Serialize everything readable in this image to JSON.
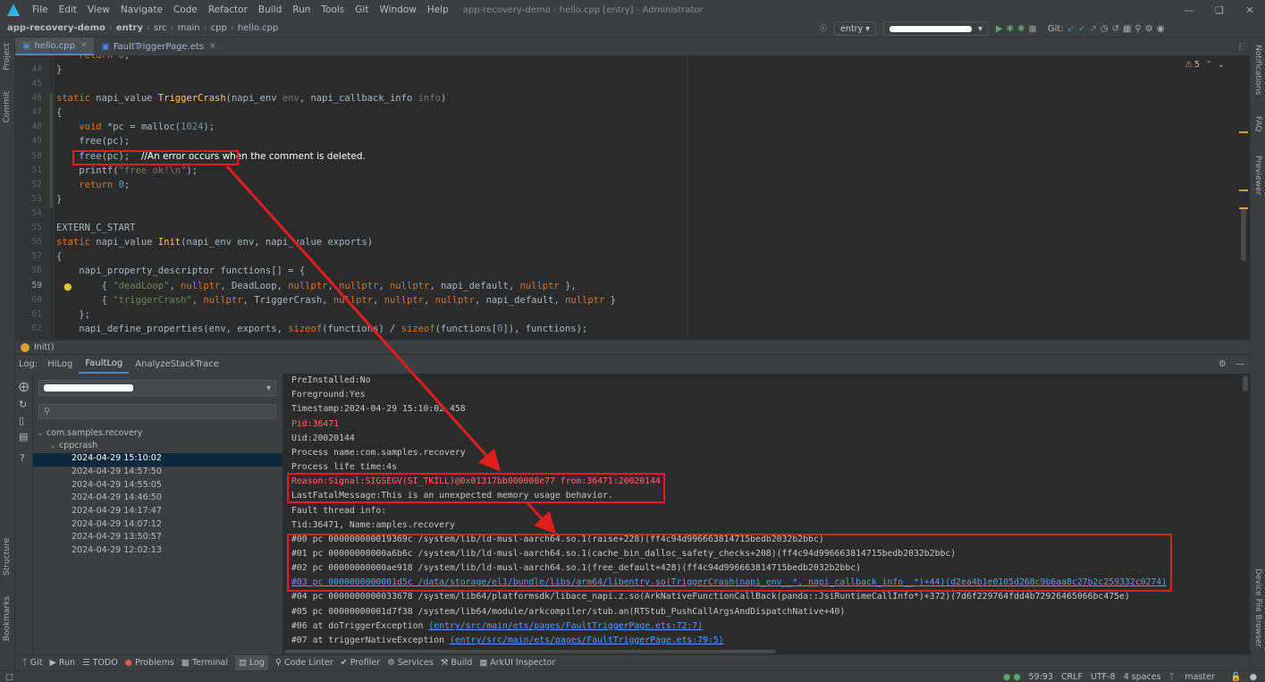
{
  "menu": {
    "items": [
      "File",
      "Edit",
      "View",
      "Navigate",
      "Code",
      "Refactor",
      "Build",
      "Run",
      "Tools",
      "Git",
      "Window",
      "Help"
    ],
    "window_title": "app-recovery-demo - hello.cpp [entry] - Administrator"
  },
  "navbar": {
    "breadcrumbs": [
      "app-recovery-demo",
      "entry",
      "src",
      "main",
      "cpp",
      "hello.cpp"
    ],
    "config": "entry",
    "git_label": "Git:"
  },
  "tabs": [
    {
      "label": "hello.cpp",
      "active": true
    },
    {
      "label": "FaultTriggerPage.ets",
      "active": false
    }
  ],
  "editor": {
    "warning_count": "5",
    "line_numbers": [
      "44",
      "45",
      "46",
      "47",
      "48",
      "49",
      "50",
      "51",
      "52",
      "53",
      "54",
      "55",
      "56",
      "57",
      "58",
      "59",
      "60",
      "61",
      "62"
    ],
    "annotation": "//An error occurs when the comment is deleted."
  },
  "errbar": {
    "text": "Init()"
  },
  "log": {
    "label": "Log:",
    "tabs": [
      "HiLog",
      "FaultLog",
      "AnalyzeStackTrace"
    ],
    "active_tab": "FaultLog",
    "tree": {
      "package": "com.samples.recovery",
      "category": "cppcrash",
      "entries": [
        "2024-04-29 15:10:02",
        "2024-04-29 14:57:50",
        "2024-04-29 14:55:05",
        "2024-04-29 14:46:50",
        "2024-04-29 14:17:47",
        "2024-04-29 14:07:12",
        "2024-04-29 13:50:57",
        "2024-04-29 12:02:13"
      ],
      "selected": "2024-04-29 15:10:02"
    },
    "lines": [
      "PreInstalled:No",
      "Foreground:Yes",
      "Timestamp:2024-04-29 15:10:02.458",
      "Pid:36471",
      "Uid:20020144",
      "Process name:com.samples.recovery",
      "Process life time:4s",
      "Reason:Signal:SIGSEGV(SI_TKILL)@0x01317bb000008e77 from:36471:20020144",
      "LastFatalMessage:This is an unexpected memory usage behavior.",
      "Fault thread info:",
      "Tid:36471, Name:amples.recovery",
      "#00 pc 000000000019369c /system/lib/ld-musl-aarch64.so.1(raise+228)(ff4c94d996663814715bedb2032b2bbc)",
      "#01 pc 00000000000a6b6c /system/lib/ld-musl-aarch64.so.1(cache_bin_dalloc_safety_checks+208)(ff4c94d996663814715bedb2032b2bbc)",
      "#02 pc 00000000000ae918 /system/lib/ld-musl-aarch64.so.1(free_default+428)(ff4c94d996663814715bedb2032b2bbc)",
      "#03 pc 0000000000001d5c /data/storage/el1/bundle/libs/arm64/libentry.so(TriggerCrash(napi_env__*, napi_callback_info__*)+44)(d2ea4b1e0105d268c9b6aa8c27b2c259332c0274)",
      "#04 pc 0000000000033678 /system/lib64/platformsdk/libace_napi.z.so(ArkNativeFunctionCallBack(panda::JsiRuntimeCallInfo*)+372)(7d6f229764fdd4b72926465066bc475e)",
      "#05 pc 00000000001d7f38 /system/lib64/module/arkcompiler/stub.an(RTStub_PushCallArgsAndDispatchNative+40)",
      "#06 at doTriggerException",
      "#07 at triggerNativeException"
    ],
    "links": {
      "l06": "(entry/src/main/ets/pages/FaultTriggerPage.ets:72:7)",
      "l07": "(entry/src/main/ets/pages/FaultTriggerPage.ets:79:5)"
    }
  },
  "bottom_tools": [
    "Git",
    "Run",
    "TODO",
    "Problems",
    "Terminal",
    "Log",
    "Code Linter",
    "Profiler",
    "Services",
    "Build",
    "ArkUI Inspector"
  ],
  "status": {
    "position": "59:93",
    "line_sep": "CRLF",
    "encoding": "UTF-8",
    "indent": "4 spaces",
    "branch": "master"
  },
  "side_labels": {
    "left": [
      "Project",
      "Commit",
      "Structure",
      "Bookmarks"
    ],
    "right": [
      "Notifications",
      "FAQ",
      "Previewer",
      "Device File Browser"
    ]
  }
}
